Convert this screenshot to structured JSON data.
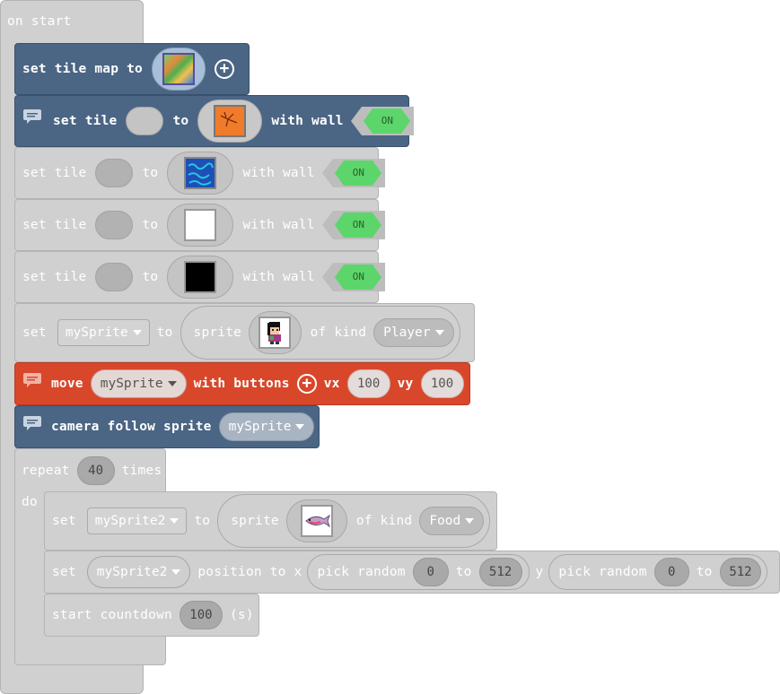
{
  "event": {
    "label": "on start"
  },
  "tilemap": {
    "label": "set tile map to"
  },
  "settile": {
    "set": "set tile",
    "to": "to",
    "wall": "with wall"
  },
  "toggle": {
    "on": "ON"
  },
  "sprite_stmt": {
    "set": "set",
    "var": "mySprite",
    "to": "to",
    "sprite": "sprite",
    "ofkind": "of kind",
    "kind": "Player"
  },
  "move": {
    "label": "move",
    "var": "mySprite",
    "with": "with buttons",
    "vx_label": "vx",
    "vx": "100",
    "vy_label": "vy",
    "vy": "100"
  },
  "camera": {
    "label": "camera follow sprite",
    "var": "mySprite"
  },
  "repeat": {
    "label": "repeat",
    "count": "40",
    "times": "times",
    "do": "do"
  },
  "food": {
    "set": "set",
    "var": "mySprite2",
    "to": "to",
    "sprite": "sprite",
    "ofkind": "of kind",
    "kind": "Food"
  },
  "position": {
    "set": "set",
    "var": "mySprite2",
    "posx": "position to x",
    "pick": "pick random",
    "from": "0",
    "to": "to",
    "max": "512",
    "y": "y"
  },
  "countdown": {
    "label": "start countdown",
    "value": "100",
    "unit": "(s)"
  },
  "colors": {
    "grey_block": "#d0d0d0",
    "navy_block": "#4b6584",
    "orange_block": "#d9472b",
    "toggle_on": "#5cd66b"
  }
}
